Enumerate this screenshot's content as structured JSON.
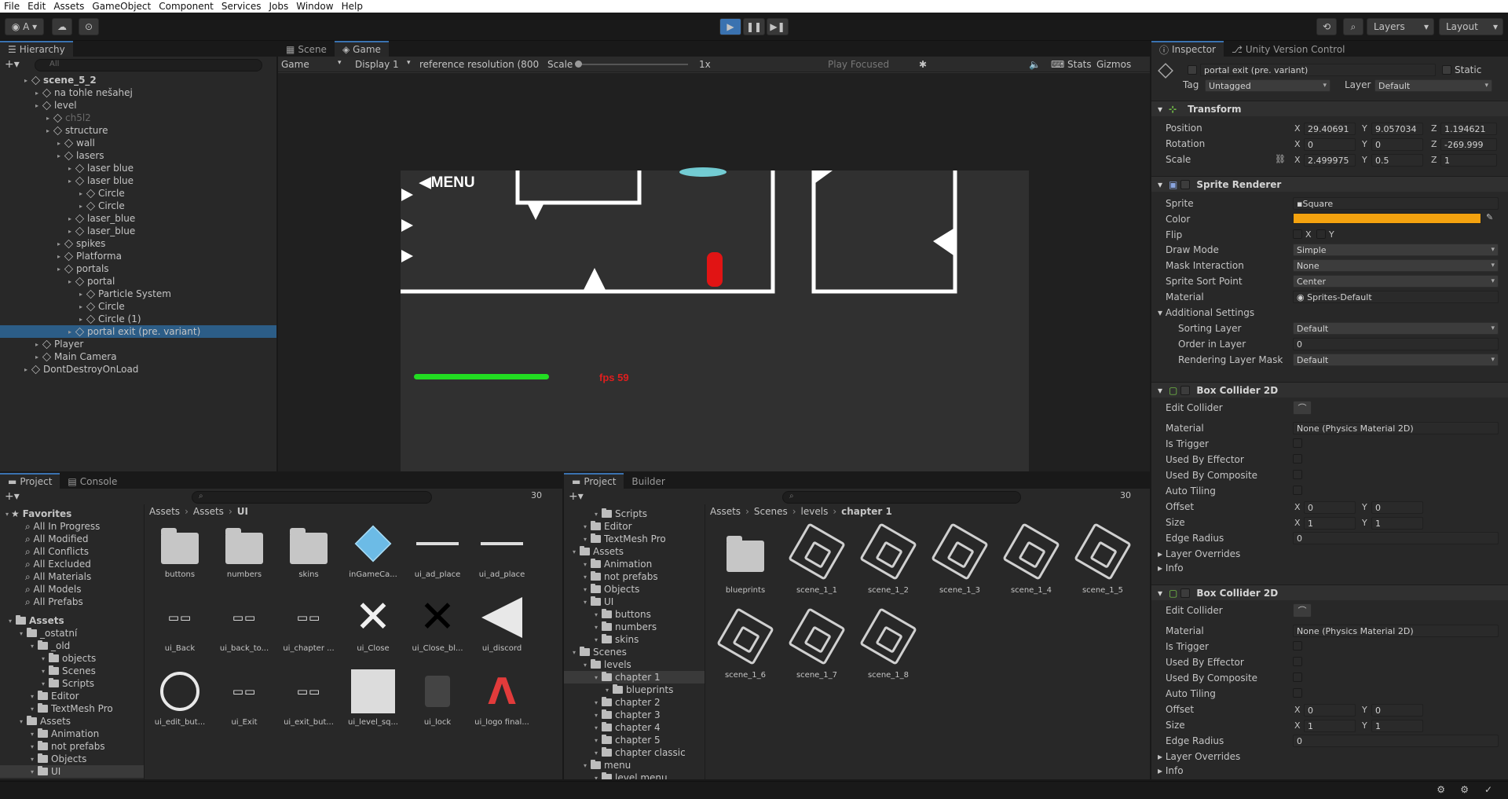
{
  "menu": [
    "File",
    "Edit",
    "Assets",
    "GameObject",
    "Component",
    "Services",
    "Jobs",
    "Window",
    "Help"
  ],
  "toolbar": {
    "account": "A",
    "layers": "Layers",
    "layout": "Layout"
  },
  "hierarchy": {
    "tab": "Hierarchy",
    "search_placeholder": "All",
    "items": [
      {
        "label": "scene_5_2",
        "depth": 0,
        "bold": true
      },
      {
        "label": "na tohle nešahej",
        "depth": 1
      },
      {
        "label": "level",
        "depth": 1
      },
      {
        "label": "ch5l2",
        "depth": 2,
        "dim": true
      },
      {
        "label": "structure",
        "depth": 2
      },
      {
        "label": "wall",
        "depth": 3
      },
      {
        "label": "lasers",
        "depth": 3
      },
      {
        "label": "laser blue",
        "depth": 4
      },
      {
        "label": "laser blue",
        "depth": 4
      },
      {
        "label": "Circle",
        "depth": 5
      },
      {
        "label": "Circle",
        "depth": 5
      },
      {
        "label": "laser_blue",
        "depth": 4
      },
      {
        "label": "laser_blue",
        "depth": 4
      },
      {
        "label": "spikes",
        "depth": 3
      },
      {
        "label": "Platforma",
        "depth": 3
      },
      {
        "label": "portals",
        "depth": 3
      },
      {
        "label": "portal",
        "depth": 4
      },
      {
        "label": "Particle System",
        "depth": 5
      },
      {
        "label": "Circle",
        "depth": 5
      },
      {
        "label": "Circle (1)",
        "depth": 5
      },
      {
        "label": "portal exit (pre. variant)",
        "depth": 4,
        "selected": true
      },
      {
        "label": "Player",
        "depth": 1
      },
      {
        "label": "Main Camera",
        "depth": 1
      },
      {
        "label": "DontDestroyOnLoad",
        "depth": 0
      }
    ]
  },
  "game": {
    "tabs": [
      "Scene",
      "Game"
    ],
    "display_mode": "Game",
    "display": "Display 1",
    "resolution": "reference resolution (800",
    "scale_label": "Scale",
    "scale_value": "1x",
    "play_focused": "Play Focused",
    "stats": "Stats",
    "gizmos": "Gizmos",
    "menu_text": "◀MENU",
    "fps": "fps 59",
    "health_fraction": 1.0
  },
  "inspector": {
    "tabs": [
      "Inspector",
      "Unity Version Control"
    ],
    "object_name": "portal exit (pre. variant)",
    "static": "Static",
    "tag_label": "Tag",
    "tag": "Untagged",
    "layer_label": "Layer",
    "layer": "Default",
    "transform": {
      "title": "Transform",
      "position": {
        "label": "Position",
        "x": "29.40691",
        "y": "9.057034",
        "z": "1.194621"
      },
      "rotation": {
        "label": "Rotation",
        "x": "0",
        "y": "0",
        "z": "-269.999"
      },
      "scale": {
        "label": "Scale",
        "x": "2.499975",
        "y": "0.5",
        "z": "1"
      }
    },
    "sprite_renderer": {
      "title": "Sprite Renderer",
      "sprite_label": "Sprite",
      "sprite": "Square",
      "color_label": "Color",
      "color": "#f5a30f",
      "flip_label": "Flip",
      "draw_mode_label": "Draw Mode",
      "draw_mode": "Simple",
      "mask_label": "Mask Interaction",
      "mask": "None",
      "sort_point_label": "Sprite Sort Point",
      "sort_point": "Center",
      "material_label": "Material",
      "material": "Sprites-Default",
      "additional": "Additional Settings",
      "sorting_layer_label": "Sorting Layer",
      "sorting_layer": "Default",
      "order_label": "Order in Layer",
      "order": "0",
      "rlm_label": "Rendering Layer Mask",
      "rlm": "Default"
    },
    "box_collider": {
      "title": "Box Collider 2D",
      "edit": "Edit Collider",
      "material_label": "Material",
      "material": "None (Physics Material 2D)",
      "is_trigger": "Is Trigger",
      "used_effector": "Used By Effector",
      "used_composite": "Used By Composite",
      "auto_tiling": "Auto Tiling",
      "offset_label": "Offset",
      "size_label": "Size",
      "edge_label": "Edge Radius",
      "overrides": "Layer Overrides",
      "info": "Info",
      "offset_x": "0",
      "offset_y": "0",
      "size_x": "1",
      "size_y": "1",
      "edge": "0"
    }
  },
  "project1": {
    "tabs": [
      "Project",
      "Console"
    ],
    "count": "30",
    "favorites_title": "Favorites",
    "favorites": [
      "All In Progress",
      "All Modified",
      "All Conflicts",
      "All Excluded",
      "All Materials",
      "All Models",
      "All Prefabs"
    ],
    "tree": [
      {
        "label": "Assets",
        "depth": 0,
        "bold": true
      },
      {
        "label": "_ostatní",
        "depth": 1
      },
      {
        "label": "_old",
        "depth": 2
      },
      {
        "label": "objects",
        "depth": 3
      },
      {
        "label": "Scenes",
        "depth": 3
      },
      {
        "label": "Scripts",
        "depth": 3
      },
      {
        "label": "Editor",
        "depth": 2
      },
      {
        "label": "TextMesh Pro",
        "depth": 2
      },
      {
        "label": "Assets",
        "depth": 1
      },
      {
        "label": "Animation",
        "depth": 2
      },
      {
        "label": "not prefabs",
        "depth": 2
      },
      {
        "label": "Objects",
        "depth": 2
      },
      {
        "label": "UI",
        "depth": 2,
        "selected": true
      }
    ],
    "breadcrumb": [
      "Assets",
      "Assets",
      "UI"
    ],
    "assets": [
      "buttons",
      "numbers",
      "skins",
      "inGameCa...",
      "ui_ad_place",
      "ui_ad_place",
      "ui_Back",
      "ui_back_to...",
      "ui_chapter ...",
      "ui_Close",
      "ui_Close_bl...",
      "ui_discord",
      "ui_edit_but...",
      "ui_Exit",
      "ui_exit_but...",
      "ui_level_sq...",
      "ui_lock",
      "ui_logo final..."
    ]
  },
  "project2": {
    "tabs": [
      "Project",
      "Builder"
    ],
    "count": "30",
    "tree": [
      {
        "label": "Scripts",
        "depth": 2
      },
      {
        "label": "Editor",
        "depth": 1
      },
      {
        "label": "TextMesh Pro",
        "depth": 1
      },
      {
        "label": "Assets",
        "depth": 0
      },
      {
        "label": "Animation",
        "depth": 1
      },
      {
        "label": "not prefabs",
        "depth": 1
      },
      {
        "label": "Objects",
        "depth": 1
      },
      {
        "label": "UI",
        "depth": 1
      },
      {
        "label": "buttons",
        "depth": 2
      },
      {
        "label": "numbers",
        "depth": 2
      },
      {
        "label": "skins",
        "depth": 2
      },
      {
        "label": "Scenes",
        "depth": 0
      },
      {
        "label": "levels",
        "depth": 1
      },
      {
        "label": "chapter 1",
        "depth": 2,
        "selected": true
      },
      {
        "label": "blueprints",
        "depth": 3
      },
      {
        "label": "chapter 2",
        "depth": 2
      },
      {
        "label": "chapter 3",
        "depth": 2
      },
      {
        "label": "chapter 4",
        "depth": 2
      },
      {
        "label": "chapter 5",
        "depth": 2
      },
      {
        "label": "chapter classic",
        "depth": 2
      },
      {
        "label": "menu",
        "depth": 1
      },
      {
        "label": "level menu",
        "depth": 2
      }
    ],
    "breadcrumb": [
      "Assets",
      "Scenes",
      "levels",
      "chapter 1"
    ],
    "assets": [
      "blueprints",
      "scene_1_1",
      "scene_1_2",
      "scene_1_3",
      "scene_1_4",
      "scene_1_5",
      "scene_1_6",
      "scene_1_7",
      "scene_1_8"
    ]
  }
}
